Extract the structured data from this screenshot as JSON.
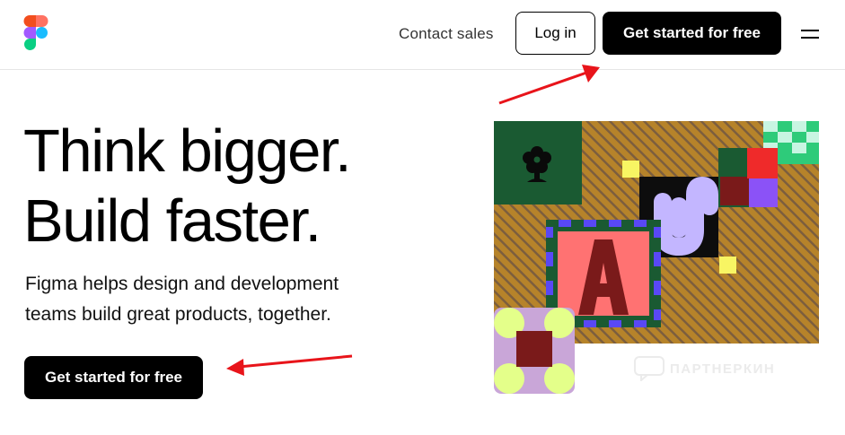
{
  "header": {
    "logo_icon": "figma-logo",
    "contact_label": "Contact sales",
    "login_label": "Log in",
    "cta_label": "Get started for free",
    "menu_icon": "hamburger-menu-icon"
  },
  "hero": {
    "headline_line1": "Think bigger.",
    "headline_line2": "Build faster.",
    "sub_line1": "Figma helps design and development",
    "sub_line2": "teams build great products, together.",
    "cta_label": "Get started for free"
  },
  "watermark": {
    "text": "ПАРТНЕРКИН",
    "icon": "chat-bubble-icon"
  },
  "colors": {
    "figma_red": "#f24e1e",
    "figma_orange": "#ff7262",
    "figma_purple": "#a259ff",
    "figma_blue": "#1abcfe",
    "figma_green": "#0acf83",
    "arrow": "#e8141a"
  }
}
